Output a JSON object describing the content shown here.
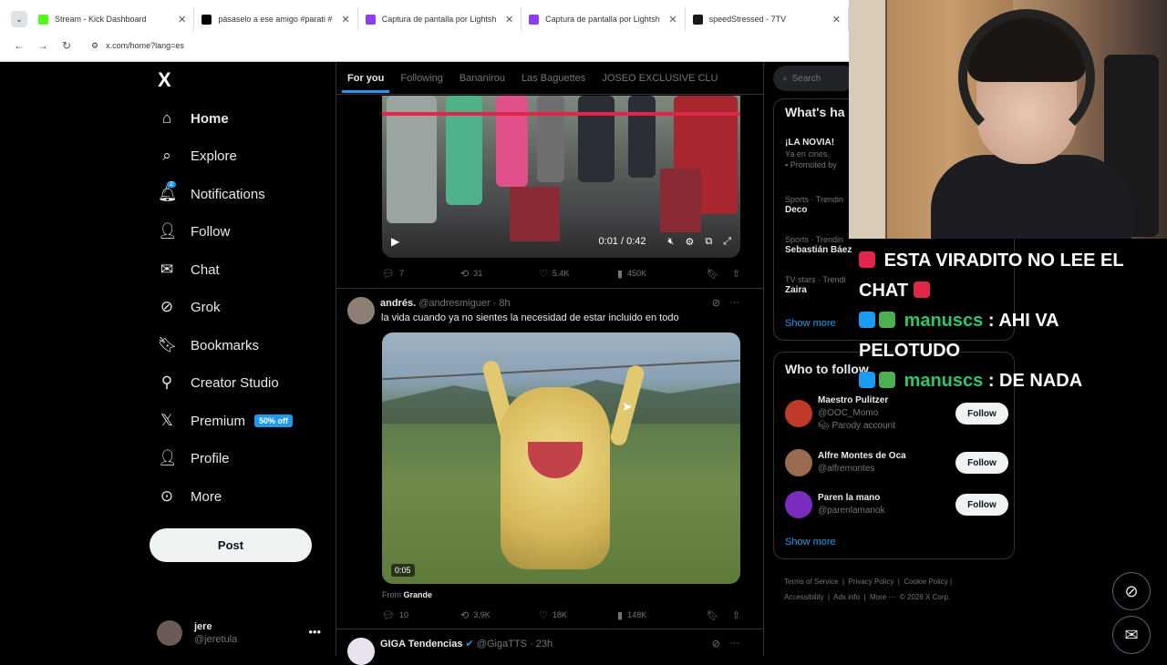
{
  "browser": {
    "tabs": [
      {
        "title": "Stream - Kick Dashboard",
        "color": "#53fc18"
      },
      {
        "title": "pásaselo a ese amigo #parati #",
        "color": "#000000"
      },
      {
        "title": "Captura de pantalla por Lightsh",
        "color": "#8a3ff0"
      },
      {
        "title": "Captura de pantalla por Lightsh",
        "color": "#8a3ff0"
      },
      {
        "title": "speedStressed - 7TV",
        "color": "#1a1a1a"
      }
    ],
    "url": "x.com/home?lang=es"
  },
  "sidebar": {
    "logo": "X",
    "items": [
      {
        "label": "Home",
        "icon": "⌂"
      },
      {
        "label": "Explore",
        "icon": "⌕"
      },
      {
        "label": "Notifications",
        "icon": "🔔︎"
      },
      {
        "label": "Follow",
        "icon": "👤︎"
      },
      {
        "label": "Chat",
        "icon": "✉"
      },
      {
        "label": "Grok",
        "icon": "⊘"
      },
      {
        "label": "Bookmarks",
        "icon": "🔖︎"
      },
      {
        "label": "Creator Studio",
        "icon": "⚲"
      },
      {
        "label": "Premium",
        "icon": "𝕏"
      },
      {
        "label": "Profile",
        "icon": "👤︎"
      },
      {
        "label": "More",
        "icon": "⊙"
      }
    ],
    "premium_badge": "50% off",
    "notif_count": "2",
    "post_label": "Post",
    "account": {
      "name": "jere",
      "handle": "@jeretula"
    }
  },
  "feed": {
    "tabs": [
      "For you",
      "Following",
      "Bananirou",
      "Las Baguettes",
      "JOSEO EXCLUSIVE CLU"
    ],
    "post1": {
      "time": "0:01 / 0:42",
      "replies": "7",
      "reposts": "31",
      "likes": "5.4K",
      "views": "450K"
    },
    "post2": {
      "name": "andrés.",
      "handle": "@andresmiguer",
      "time": "· 8h",
      "text": "la vida cuando ya no sientes la necesidad de estar incluido en todo",
      "duration": "0:05",
      "from_label": "From",
      "from_name": "Grande",
      "replies": "10",
      "reposts": "3.9K",
      "likes": "18K",
      "views": "148K"
    },
    "post3": {
      "name": "GIGA Tendencias",
      "handle": "@GigaTTS",
      "time": "· 23h"
    }
  },
  "right": {
    "search_placeholder": "Search",
    "whats_happening": "What's ha",
    "trends": [
      {
        "title": "¡LA NOVIA!",
        "sub1": "Ya en cines.",
        "sub2": "Promoted by"
      },
      {
        "category": "Sports · Trendin",
        "title": "Deco"
      },
      {
        "category": "Sports · Trendin",
        "title": "Sebastián Báez"
      },
      {
        "category": "TV stars · Trendi",
        "title": "Zaira"
      }
    ],
    "show_more": "Show more",
    "who_to_follow": "Who to follow",
    "suggestions": [
      {
        "name": "Maestro Pulitzer",
        "handle": "@OOC_Momo",
        "extra": "Parody account",
        "color": "#c0392b"
      },
      {
        "name": "Alfre Montes de Oca",
        "handle": "@alfremontes",
        "extra": "",
        "color": "#9a6b4f"
      },
      {
        "name": "Paren la mano",
        "handle": "@parenlamanok",
        "extra": "",
        "color": "#7b2cbf"
      }
    ],
    "follow_label": "Follow",
    "footer": [
      "Terms of Service",
      "Privacy Policy",
      "Cookie Policy",
      "Accessibility",
      "Ads info",
      "More ···",
      "© 2026 X Corp."
    ]
  },
  "chat_overlay": [
    {
      "user": "",
      "text": "ESTA VIRADITO NO LEE EL CHAT"
    },
    {
      "user": "manuscs",
      "text": ": AHI VA PELOTUDO"
    },
    {
      "user": "manuscs",
      "text": ": DE NADA"
    }
  ]
}
